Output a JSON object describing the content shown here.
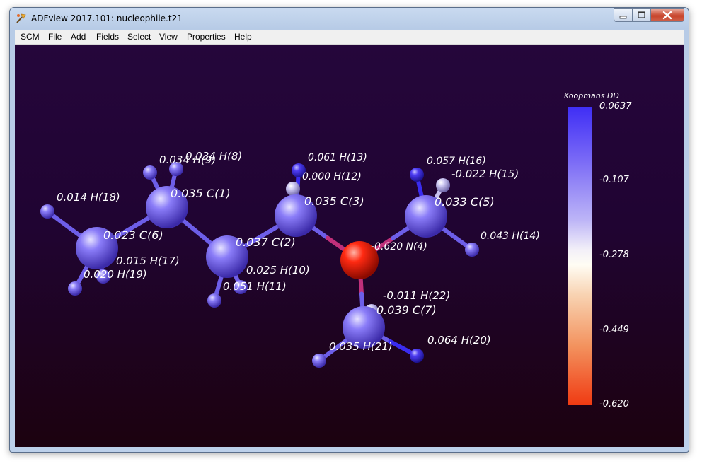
{
  "window": {
    "title": "ADFview 2017.101: nucleophile.t21"
  },
  "menubar": {
    "items": [
      "SCM",
      "File",
      "Add",
      "Fields",
      "Select",
      "View",
      "Properties",
      "Help"
    ]
  },
  "colorbar": {
    "title": "Koopmans DD",
    "ticks": [
      "0.0637",
      "-0.107",
      "-0.278",
      "-0.449",
      "-0.620"
    ],
    "max_color": "#3f2ef5",
    "mid_color": "#fffdf4",
    "min_color": "#f03a12"
  },
  "molecule": {
    "atoms": [
      {
        "label": "0.035 C(1)",
        "value": 0.035,
        "element": "C"
      },
      {
        "label": "0.037 C(2)",
        "value": 0.037,
        "element": "C"
      },
      {
        "label": "0.035 C(3)",
        "value": 0.035,
        "element": "C"
      },
      {
        "label": "-0.620 N(4)",
        "value": -0.62,
        "element": "N"
      },
      {
        "label": "0.033 C(5)",
        "value": 0.033,
        "element": "C"
      },
      {
        "label": "0.023 C(6)",
        "value": 0.023,
        "element": "C"
      },
      {
        "label": "0.039 C(7)",
        "value": 0.039,
        "element": "C"
      },
      {
        "label": "0.034 H(8)",
        "value": 0.034,
        "element": "H"
      },
      {
        "label": "0.034 H(9)",
        "value": 0.034,
        "element": "H"
      },
      {
        "label": "0.025 H(10)",
        "value": 0.025,
        "element": "H"
      },
      {
        "label": "0.051 H(11)",
        "value": 0.051,
        "element": "H"
      },
      {
        "label": "0.000 H(12)",
        "value": 0.0,
        "element": "H"
      },
      {
        "label": "0.061 H(13)",
        "value": 0.061,
        "element": "H"
      },
      {
        "label": "0.043 H(14)",
        "value": 0.043,
        "element": "H"
      },
      {
        "label": "-0.022 H(15)",
        "value": -0.022,
        "element": "H"
      },
      {
        "label": "0.057 H(16)",
        "value": 0.057,
        "element": "H"
      },
      {
        "label": "0.015 H(17)",
        "value": 0.015,
        "element": "H"
      },
      {
        "label": "0.014 H(18)",
        "value": 0.014,
        "element": "H"
      },
      {
        "label": "0.020 H(19)",
        "value": 0.02,
        "element": "H"
      },
      {
        "label": "0.064 H(20)",
        "value": 0.064,
        "element": "H"
      },
      {
        "label": "0.035 H(21)",
        "value": 0.035,
        "element": "H"
      },
      {
        "label": "-0.011 H(22)",
        "value": -0.011,
        "element": "H"
      }
    ]
  }
}
